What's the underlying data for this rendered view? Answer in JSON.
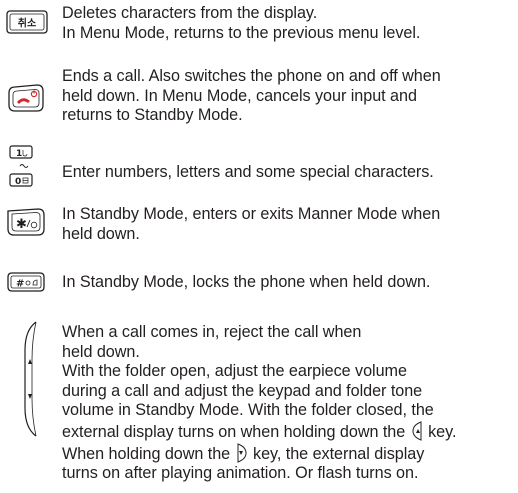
{
  "entries": [
    {
      "key_icon": "clear-key-icon",
      "key_label": "취소",
      "lines": [
        "Deletes characters from the display.",
        "In Menu Mode, returns to the previous menu level."
      ]
    },
    {
      "key_icon": "end-power-key-icon",
      "lines": [
        "Ends a call. Also switches the phone on and off when",
        "held down. In Menu Mode, cancels your input and",
        "returns to Standby Mode."
      ]
    },
    {
      "key_icon": "number-keys-icon",
      "key_labels": {
        "one": "1",
        "zero": "0"
      },
      "lines": [
        "Enter numbers, letters and some special characters."
      ]
    },
    {
      "key_icon": "star-key-icon",
      "key_label": "✱",
      "lines": [
        "In Standby Mode, enters or exits Manner Mode when",
        "held down."
      ]
    },
    {
      "key_icon": "hash-key-icon",
      "key_label": "#",
      "lines": [
        "In Standby Mode, locks the phone when held down."
      ]
    },
    {
      "key_icon": "volume-side-keys-icon",
      "lines": [
        "When a call comes in, reject the call when",
        "held down.",
        "With the folder open, adjust the earpiece volume",
        "during a call and adjust the keypad and folder tone",
        "volume in Standby Mode. With the folder closed, the",
        "external display turns on when holding down the",
        "key.",
        "When holding down the",
        "key, the external display",
        "turns on after playing animation. Or flash turns on."
      ]
    }
  ]
}
